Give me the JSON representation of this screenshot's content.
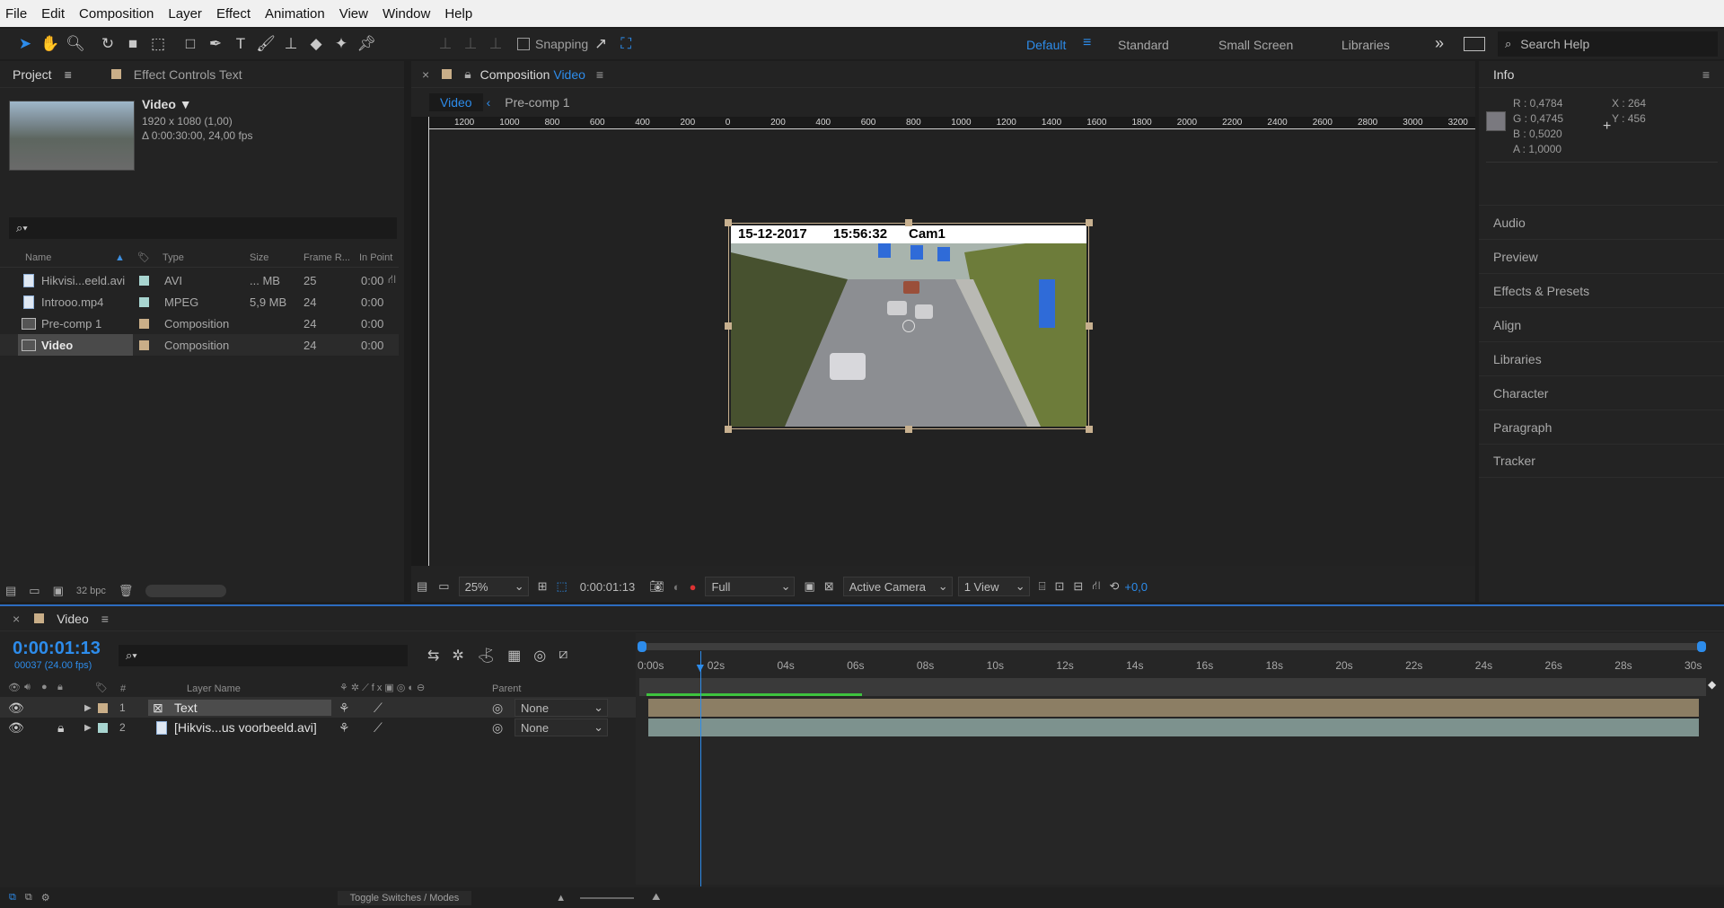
{
  "menu": [
    "File",
    "Edit",
    "Composition",
    "Layer",
    "Effect",
    "Animation",
    "View",
    "Window",
    "Help"
  ],
  "toolbar": {
    "snapping_label": "Snapping",
    "workspaces": [
      "Default",
      "Standard",
      "Small Screen",
      "Libraries"
    ],
    "more": "»",
    "search_placeholder": "Search Help"
  },
  "project": {
    "tab_project": "Project",
    "tab_effects": "Effect Controls Text",
    "selected_name": "Video ▼",
    "selected_dims": "1920 x 1080 (1,00)",
    "selected_dur": "Δ 0:00:30:00, 24,00 fps",
    "search_icon": "search-icon",
    "columns": [
      "Name",
      "Type",
      "Size",
      "Frame R...",
      "In Point"
    ],
    "items": [
      {
        "name": "Hikvisi...eeld.avi",
        "swatch": "#a8d5d0",
        "type": "AVI",
        "size": "... MB",
        "fps": "25",
        "in": "0:00",
        "icon": "file"
      },
      {
        "name": "Introoo.mp4",
        "swatch": "#a8d5d0",
        "type": "MPEG",
        "size": "5,9 MB",
        "fps": "24",
        "in": "0:00",
        "icon": "file"
      },
      {
        "name": "Pre-comp 1",
        "swatch": "#c9ae88",
        "type": "Composition",
        "size": "",
        "fps": "24",
        "in": "0:00",
        "icon": "comp"
      },
      {
        "name": "Video",
        "swatch": "#c9ae88",
        "type": "Composition",
        "size": "",
        "fps": "24",
        "in": "0:00",
        "icon": "comp"
      }
    ],
    "bpc": "32 bpc"
  },
  "composition": {
    "tab_prefix": "Composition",
    "tab_name": "Video",
    "crumbs": [
      "Video",
      "Pre-comp 1"
    ],
    "ruler_labels": [
      "1200",
      "1000",
      "800",
      "600",
      "400",
      "200",
      "0",
      "200",
      "400",
      "600",
      "800",
      "1000",
      "1200",
      "1400",
      "1600",
      "1800",
      "2000",
      "2200",
      "2400",
      "2600",
      "2800",
      "3000",
      "3200"
    ],
    "overlay": {
      "date": "15-12-2017",
      "time": "15:56:32",
      "cam": "Cam1"
    },
    "footer": {
      "zoom": "25%",
      "timecode": "0:00:01:13",
      "resolution": "Full",
      "camera": "Active Camera",
      "views": "1 View",
      "exposure": "+0,0"
    }
  },
  "info": {
    "title": "Info",
    "r": "R : 0,4784",
    "g": "G : 0,4745",
    "b": "B : 0,5020",
    "a": "A : 1,0000",
    "x": "X : 264",
    "y": "Y : 456",
    "color": "#7a797f",
    "panels": [
      "Audio",
      "Preview",
      "Effects & Presets",
      "Align",
      "Libraries",
      "Character",
      "Paragraph",
      "Tracker"
    ]
  },
  "timeline": {
    "tab": "Video",
    "timecode": "0:00:01:13",
    "frames": "00037 (24.00 fps)",
    "col_layer": "Layer Name",
    "col_num": "#",
    "col_parent": "Parent",
    "ticks": [
      "0:00s",
      "02s",
      "04s",
      "06s",
      "08s",
      "10s",
      "12s",
      "14s",
      "16s",
      "18s",
      "20s",
      "22s",
      "24s",
      "26s",
      "28s",
      "30s"
    ],
    "layers": [
      {
        "num": "1",
        "name": "Text",
        "swatch": "#c9ae88",
        "parent": "None",
        "bar": "#8c7e64"
      },
      {
        "num": "2",
        "name": "[Hikvis...us voorbeeld.avi]",
        "swatch": "#a8d5d0",
        "parent": "None",
        "bar": "#7d928e"
      }
    ],
    "toggle": "Toggle Switches / Modes",
    "playhead_seconds": 1.54,
    "duration_seconds": 30
  }
}
